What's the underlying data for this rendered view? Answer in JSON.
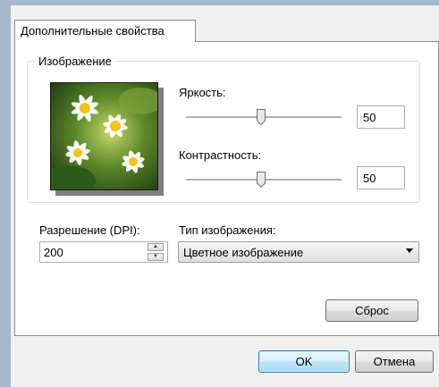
{
  "tab": {
    "label": "Дополнительные свойства"
  },
  "image_group": {
    "legend": "Изображение",
    "brightness": {
      "label": "Яркость:",
      "value": "50",
      "level_percent": 50
    },
    "contrast": {
      "label": "Контрастность:",
      "value": "50",
      "level_percent": 50
    }
  },
  "resolution": {
    "label": "Разрешение (DPI):",
    "value": "200"
  },
  "image_type": {
    "label": "Тип изображения:",
    "selected": "Цветное изображение"
  },
  "buttons": {
    "reset": "Сброс",
    "ok": "OK",
    "cancel": "Отмена"
  },
  "colors": {
    "accent_border": "#3c7fb1",
    "frame": "#a8b8cc"
  }
}
